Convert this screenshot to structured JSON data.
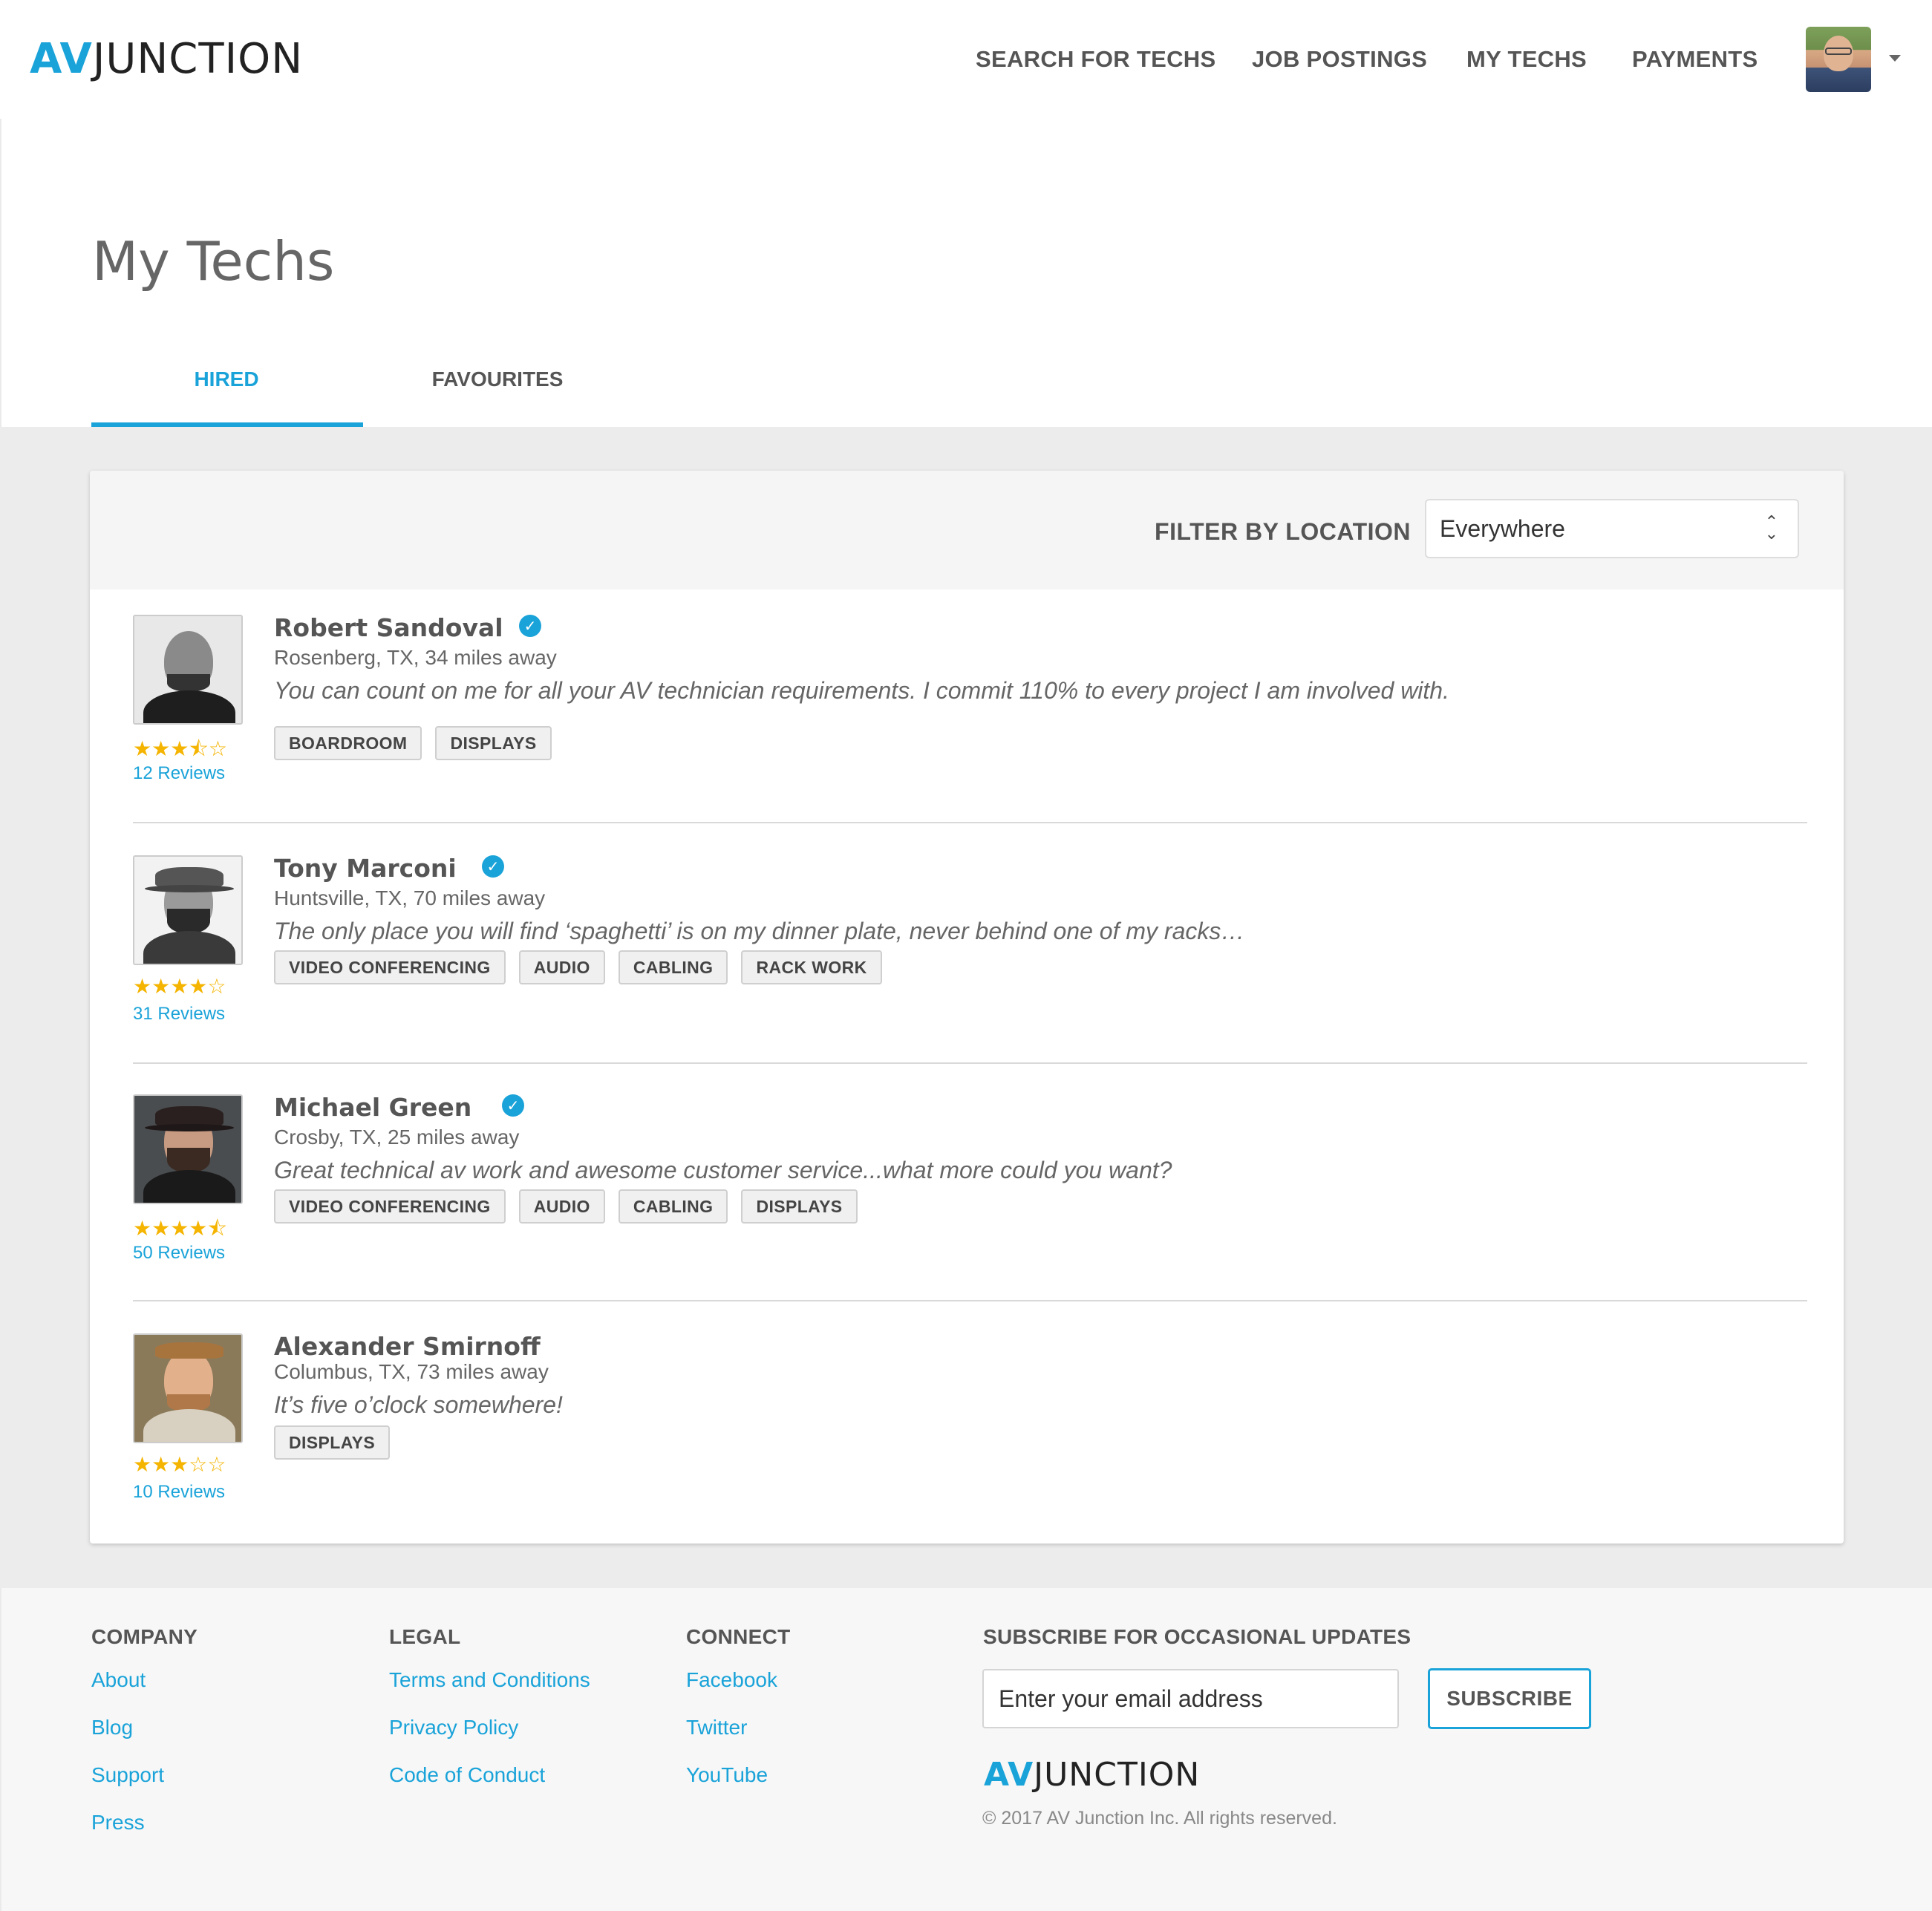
{
  "brand": {
    "logo_av": "AV",
    "logo_junction": "JUNCTION"
  },
  "nav": {
    "items": [
      "SEARCH FOR TECHS",
      "JOB POSTINGS",
      "MY TECHS",
      "PAYMENTS"
    ]
  },
  "page": {
    "title": "My Techs",
    "tabs": [
      {
        "label": "HIRED",
        "active": true
      },
      {
        "label": "FAVOURITES",
        "active": false
      }
    ]
  },
  "filter": {
    "label": "FILTER BY LOCATION",
    "selected": "Everywhere"
  },
  "techs": [
    {
      "name": "Robert Sandoval",
      "verified": true,
      "location": "Rosenberg, TX, 34 miles away",
      "quote": "You can count on me for all your AV technician requirements.  I commit 110% to every project I am involved with.",
      "tags": [
        "BOARDROOM",
        "DISPLAYS"
      ],
      "rating": 3.5,
      "stars": "★★★⯪☆",
      "reviews": "12 Reviews"
    },
    {
      "name": "Tony Marconi",
      "verified": true,
      "location": "Huntsville, TX, 70 miles away",
      "quote": "The only place you will find ‘spaghetti’ is on my dinner plate, never behind one of my racks…",
      "tags": [
        "VIDEO CONFERENCING",
        "AUDIO",
        "CABLING",
        "RACK WORK"
      ],
      "rating": 4,
      "stars": "★★★★☆",
      "reviews": "31 Reviews"
    },
    {
      "name": "Michael Green",
      "verified": true,
      "location": "Crosby, TX, 25 miles away",
      "quote": "Great technical av work and awesome customer service...what more could you want?",
      "tags": [
        "VIDEO CONFERENCING",
        "AUDIO",
        "CABLING",
        "DISPLAYS"
      ],
      "rating": 4.5,
      "stars": "★★★★⯪",
      "reviews": "50 Reviews"
    },
    {
      "name": "Alexander Smirnoff",
      "verified": false,
      "location": "Columbus, TX, 73 miles away",
      "quote": "It’s five o’clock somewhere!",
      "tags": [
        "DISPLAYS"
      ],
      "rating": 3,
      "stars": "★★★☆☆",
      "reviews": "10 Reviews"
    }
  ],
  "footer": {
    "company": {
      "heading": "COMPANY",
      "links": [
        "About",
        "Blog",
        "Support",
        "Press"
      ]
    },
    "legal": {
      "heading": "LEGAL",
      "links": [
        "Terms and Conditions",
        "Privacy Policy",
        "Code of Conduct"
      ]
    },
    "connect": {
      "heading": "CONNECT",
      "links": [
        "Facebook",
        "Twitter",
        "YouTube"
      ]
    },
    "subscribe": {
      "heading": "SUBSCRIBE FOR OCCASIONAL UPDATES",
      "placeholder": "Enter your email address",
      "button": "SUBSCRIBE"
    },
    "copyright": "© 2017 AV Junction Inc. All rights reserved."
  },
  "colors": {
    "accent": "#1aa3d9",
    "star": "#f4b400"
  },
  "icons": {
    "verified": "verified-check-icon",
    "star": "star-icon",
    "select": "select-arrows-icon",
    "dropdown": "caret-down-icon"
  }
}
